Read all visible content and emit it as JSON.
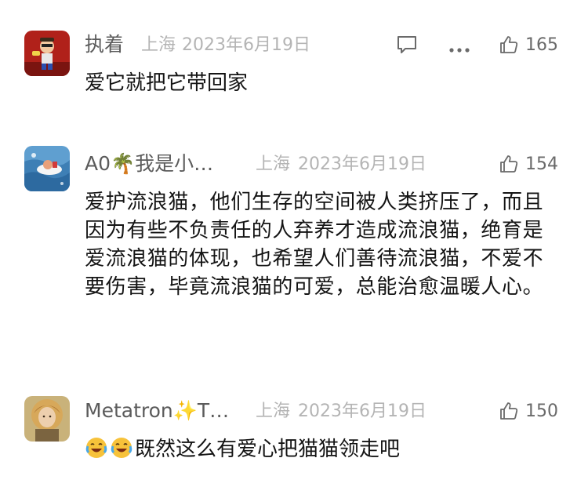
{
  "comments": [
    {
      "username": "执着",
      "location": "上海",
      "date": "2023年6月19日",
      "likes": "165",
      "text": "爱它就把它带回家",
      "avatar_icon": "red-cartoon-avatar-icon"
    },
    {
      "username": "A0🌴我是小…",
      "location": "上海",
      "date": "2023年6月19日",
      "likes": "154",
      "text": "爱护流浪猫，他们生存的空间被人类挤压了，而且因为有些不负责任的人弃养才造成流浪猫，绝育是爱流浪猫的体现，也希望人们善待流浪猫，不爱不要伤害，毕竟流浪猫的可爱，总能治愈温暖人心。",
      "avatar_icon": "boat-on-water-avatar-icon"
    },
    {
      "username": "Metatron✨T…",
      "location": "上海",
      "date": "2023年6月19日",
      "likes": "150",
      "text": "既然这么有爱心把猫猫领走吧",
      "emojis": [
        "crying-laughing-emoji",
        "crying-laughing-emoji"
      ],
      "avatar_icon": "painted-portrait-avatar-icon"
    }
  ],
  "colors": {
    "username": "#5b5b5b",
    "meta": "#b4b4b4",
    "body": "#141414",
    "icon": "#6a6a6a"
  }
}
